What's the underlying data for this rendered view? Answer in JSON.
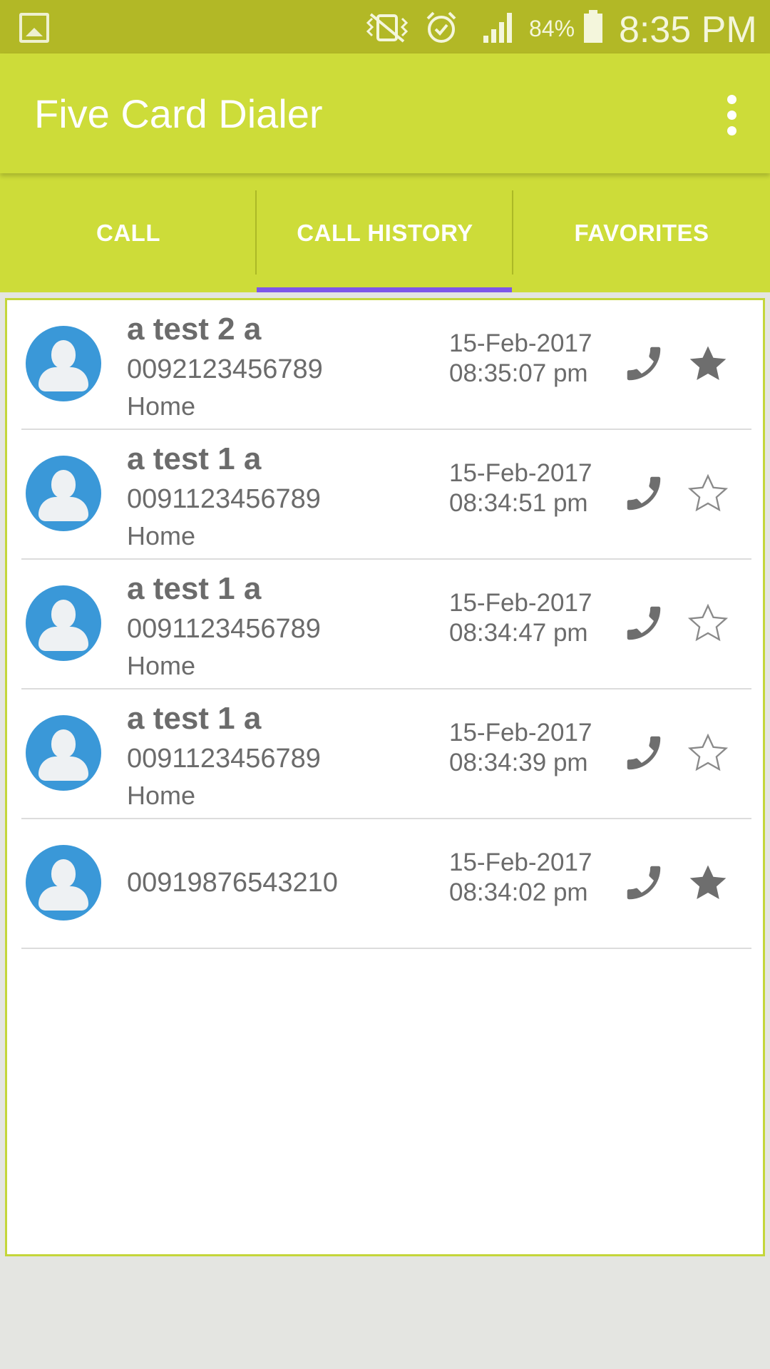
{
  "status_bar": {
    "battery_percent": "84%",
    "time": "8:35 PM",
    "icons": [
      "gallery-icon",
      "vibrate-icon",
      "alarm-icon",
      "signal-icon",
      "battery-icon"
    ]
  },
  "app_bar": {
    "title": "Five Card Dialer",
    "menu_icon": "overflow-menu-icon"
  },
  "tabs": [
    {
      "label": "CALL",
      "selected": false
    },
    {
      "label": "CALL HISTORY",
      "selected": true
    },
    {
      "label": "FAVORITES",
      "selected": false
    }
  ],
  "colors": {
    "status_bar": "#b2b826",
    "primary": "#cddc39",
    "tab_indicator": "#7e57e8",
    "avatar": "#3a98d8",
    "icon_gray": "#6e6e6e"
  },
  "call_history": [
    {
      "name": "a test 2 a",
      "number": "0092123456789",
      "label": "Home",
      "date": "15-Feb-2017",
      "time": "08:35:07 pm",
      "favorite": true
    },
    {
      "name": "a test 1 a",
      "number": "0091123456789",
      "label": "Home",
      "date": "15-Feb-2017",
      "time": "08:34:51 pm",
      "favorite": false
    },
    {
      "name": "a test 1 a",
      "number": "0091123456789",
      "label": "Home",
      "date": "15-Feb-2017",
      "time": "08:34:47 pm",
      "favorite": false
    },
    {
      "name": "a test 1 a",
      "number": "0091123456789",
      "label": "Home",
      "date": "15-Feb-2017",
      "time": "08:34:39 pm",
      "favorite": false
    },
    {
      "name": "",
      "number": "00919876543210",
      "label": "",
      "date": "15-Feb-2017",
      "time": "08:34:02 pm",
      "favorite": true
    }
  ]
}
